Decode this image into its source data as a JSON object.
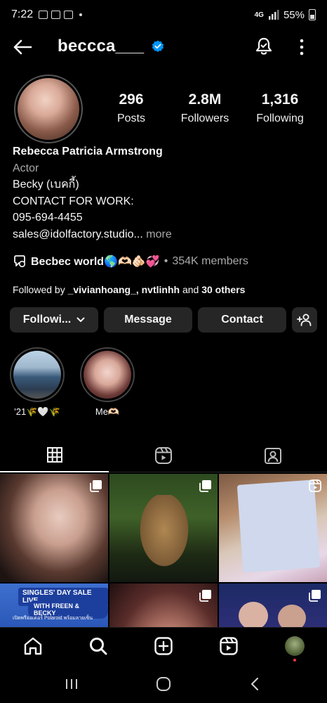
{
  "status_bar": {
    "time": "7:22",
    "battery": "55%",
    "network": "4G"
  },
  "header": {
    "username": "beccca___"
  },
  "profile": {
    "stats": [
      {
        "value": "296",
        "label": "Posts"
      },
      {
        "value": "2.8M",
        "label": "Followers"
      },
      {
        "value": "1,316",
        "label": "Following"
      }
    ],
    "name": "Rebecca Patricia Armstrong",
    "category": "Actor",
    "bio_lines": [
      "Becky (เบคกี้)",
      "CONTACT FOR WORK:",
      "095-694-4455",
      "sales@idolfactory.studio..."
    ],
    "more_label": " more"
  },
  "channel": {
    "name": "Becbec world🌎🫶🏻🫵🏻💞",
    "separator": "•",
    "members": "354K members"
  },
  "followed_by": {
    "prefix": "Followed by ",
    "users": "_vivianhoang_, nvtlinhh",
    "middle": " and ",
    "others": "30 others"
  },
  "buttons": {
    "following": "Followi...",
    "message": "Message",
    "contact": "Contact"
  },
  "highlights": [
    {
      "caption": "'21🌾🤍🌾"
    },
    {
      "caption": "Me🫶🏻"
    }
  ],
  "posts": {
    "promo_title": "SINGLES' DAY SALE LIVE",
    "promo_sub": "WITH FREEN & BECKY",
    "promo_line": "เปิดพรีออเดอร์ Polaroid พร้อมลายเซ็น"
  },
  "colors": {
    "background": "#000000",
    "button": "#262626",
    "verified": "#0095f6",
    "muted": "#a8a8a8",
    "notification_dot": "#ff3040"
  }
}
